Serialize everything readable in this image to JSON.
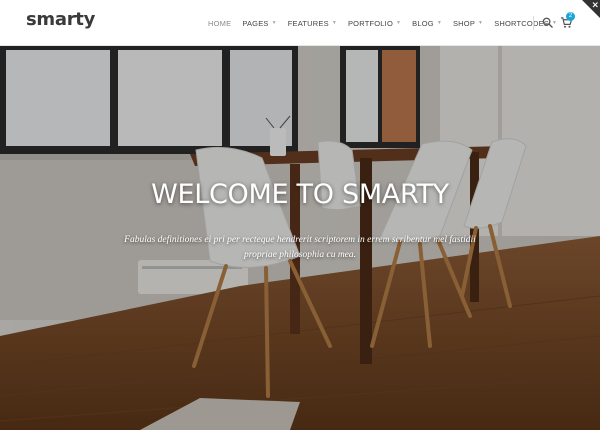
{
  "brand": {
    "logo_text": "smarty"
  },
  "nav": {
    "items": [
      {
        "label": "HOME",
        "dropdown": false,
        "active": true
      },
      {
        "label": "PAGES",
        "dropdown": true
      },
      {
        "label": "FEATURES",
        "dropdown": true
      },
      {
        "label": "PORTFOLIO",
        "dropdown": true
      },
      {
        "label": "BLOG",
        "dropdown": true
      },
      {
        "label": "SHOP",
        "dropdown": true
      },
      {
        "label": "SHORTCODES",
        "dropdown": true
      }
    ],
    "search_icon": "search-icon",
    "cart_icon": "cart-icon",
    "cart_count": "2",
    "accent_color": "#1aa5d8"
  },
  "hero": {
    "title": "WELCOME TO SMARTY",
    "subtitle": "Fabulas definitiones ei pri per recteque hendrerit scriptorem in errem scribentur mel fastidii propriae philosophia cu mea."
  }
}
